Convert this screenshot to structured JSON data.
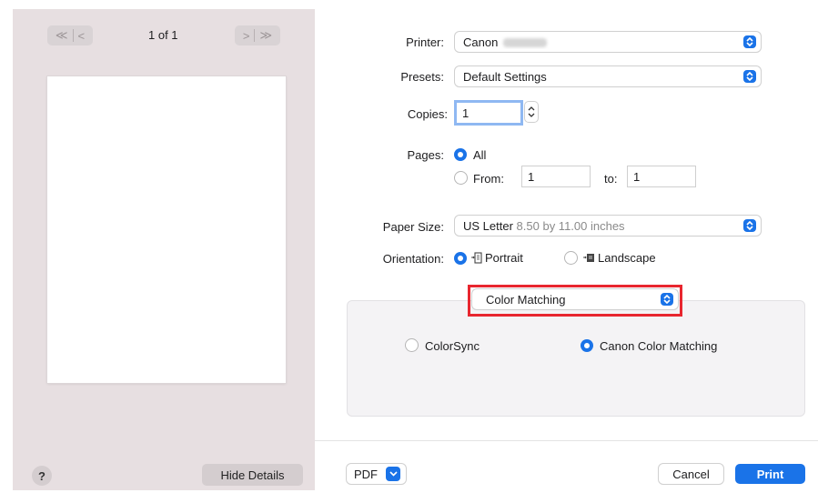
{
  "preview": {
    "page_counter": "1 of 1",
    "nav_first_prev": [
      "≪",
      "<"
    ],
    "nav_next_last": [
      ">",
      "≫"
    ],
    "help_label": "?",
    "hide_details_label": "Hide Details"
  },
  "settings": {
    "printer_label": "Printer:",
    "printer_value": "Canon",
    "presets_label": "Presets:",
    "presets_value": "Default Settings",
    "copies_label": "Copies:",
    "copies_value": "1",
    "pages_label": "Pages:",
    "pages_all_label": "All",
    "pages_from_label": "From:",
    "pages_from_value": "1",
    "pages_to_label": "to:",
    "pages_to_value": "1",
    "paper_size_label": "Paper Size:",
    "paper_size_value": "US Letter",
    "paper_size_detail": "8.50 by 11.00 inches",
    "orientation_label": "Orientation:",
    "orientation_portrait": "Portrait",
    "orientation_landscape": "Landscape",
    "panel_select_value": "Color Matching",
    "colorsync_label": "ColorSync",
    "canon_color_matching_label": "Canon Color Matching"
  },
  "footer": {
    "pdf_label": "PDF",
    "cancel_label": "Cancel",
    "print_label": "Print"
  },
  "colors": {
    "accent": "#1a73e8",
    "sidebar_bg": "#e7dfe1",
    "highlight": "#e8262f"
  }
}
